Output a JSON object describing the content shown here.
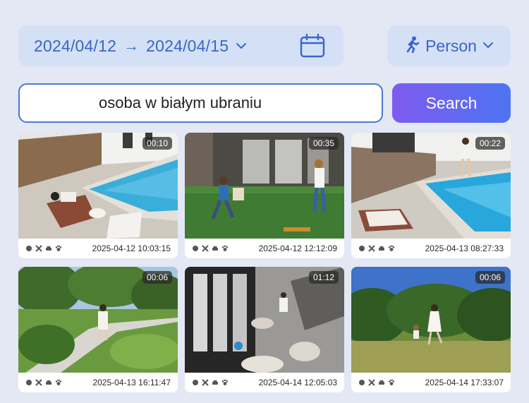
{
  "filter": {
    "date_start": "2024/04/12",
    "arrow": "→",
    "date_end": "2024/04/15",
    "calendar_icon": "calendar-icon",
    "detection_type": "Person",
    "detection_icon": "running-person-icon"
  },
  "search": {
    "query": "osoba w białym ubraniu",
    "button_label": "Search"
  },
  "clips": [
    {
      "duration": "00:10",
      "timestamp": "2025-04-12 10:03:15",
      "scene": "pool-lounger"
    },
    {
      "duration": "00:35",
      "timestamp": "2025-04-12 12:12:09",
      "scene": "backyard-kids"
    },
    {
      "duration": "00:22",
      "timestamp": "2025-04-13 08:27:33",
      "scene": "pool-walker"
    },
    {
      "duration": "00:06",
      "timestamp": "2025-04-13 16:11:47",
      "scene": "garden-path"
    },
    {
      "duration": "01:12",
      "timestamp": "2025-04-14 12:05:03",
      "scene": "living-room-overhead"
    },
    {
      "duration": "00:06",
      "timestamp": "2025-04-14 17:33:07",
      "scene": "field-running"
    }
  ],
  "meta_icons": [
    "motion-icon",
    "tools-icon",
    "car-icon",
    "paw-icon"
  ],
  "colors": {
    "accent": "#3766c9",
    "chip_bg": "#d4e0f5",
    "page_bg": "#e3e8f4",
    "button_gradient_start": "#7f5bf0",
    "button_gradient_end": "#4d74f2"
  }
}
